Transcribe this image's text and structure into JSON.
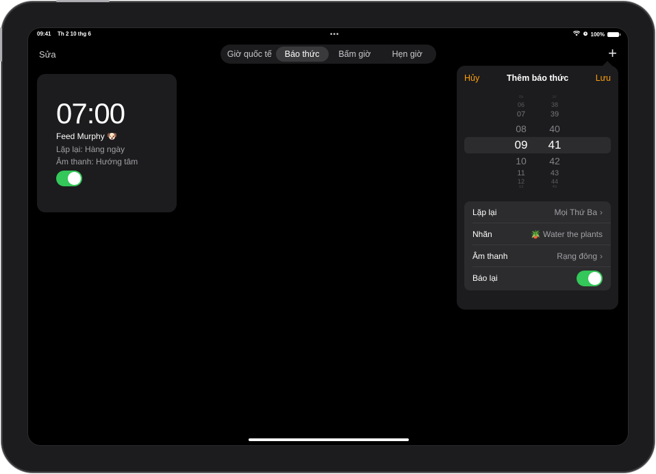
{
  "status": {
    "time": "09:41",
    "date": "Th 2 10 thg 6",
    "battery": "100%"
  },
  "toolbar": {
    "edit_label": "Sửa",
    "add_symbol": "+"
  },
  "tabs": [
    {
      "label": "Giờ quốc tế",
      "active": false
    },
    {
      "label": "Báo thức",
      "active": true
    },
    {
      "label": "Bấm giờ",
      "active": false
    },
    {
      "label": "Hẹn giờ",
      "active": false
    }
  ],
  "alarm": {
    "time": "07:00",
    "label": "Feed Murphy 🐶",
    "repeat": "Lặp lại: Hàng ngày",
    "sound": "Âm thanh: Hướng tâm",
    "enabled": true
  },
  "add_alarm": {
    "cancel": "Hủy",
    "title": "Thêm báo thức",
    "save": "Lưu",
    "hours": [
      "05",
      "06",
      "07",
      "08",
      "09",
      "10",
      "11",
      "12",
      "13"
    ],
    "minutes": [
      "37",
      "38",
      "39",
      "40",
      "41",
      "42",
      "43",
      "44",
      "45"
    ],
    "selected_hour": "09",
    "selected_minute": "41",
    "rows": [
      {
        "key": "Lặp lại",
        "value": "Mọi Thứ Ba"
      },
      {
        "key": "Nhãn",
        "value": "🪴 Water the plants"
      },
      {
        "key": "Âm thanh",
        "value": "Rạng đông"
      },
      {
        "key": "Báo lại",
        "enabled": true
      }
    ]
  },
  "colors": {
    "accent": "#ff9f0a",
    "toggle_on": "#34c759",
    "card": "#1c1c1e"
  }
}
